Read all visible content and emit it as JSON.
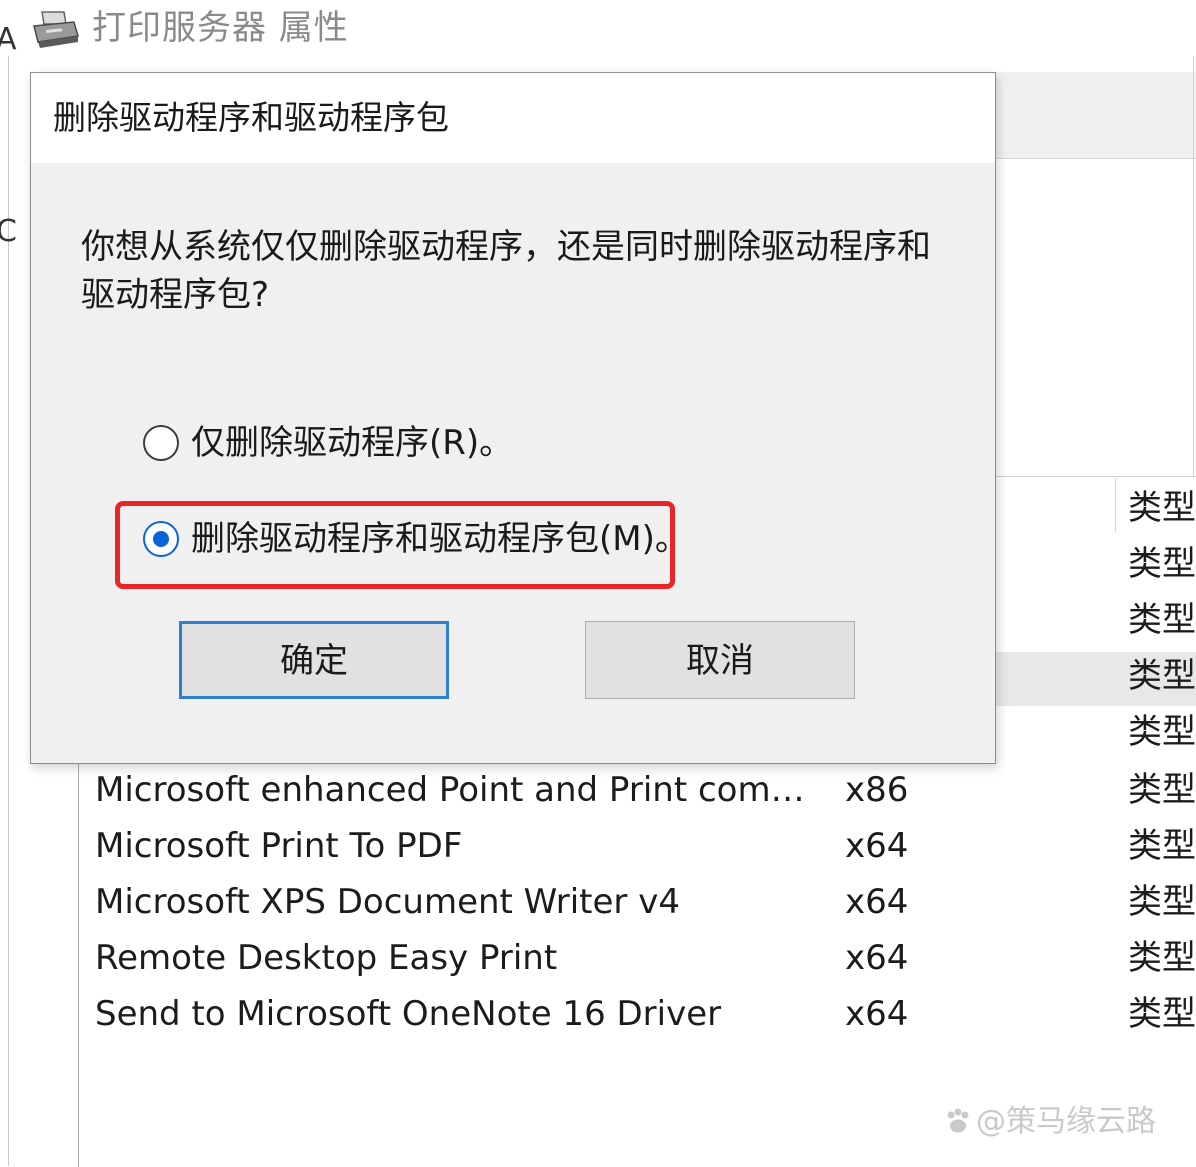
{
  "background_window": {
    "title": "打印服务器 属性",
    "left_edge_glyphs": [
      "A",
      "C"
    ],
    "drivers": [
      {
        "name": "Microsoft enhanced Point and Print com…",
        "environment": "x86",
        "type": "类型"
      },
      {
        "name": "Microsoft Print To PDF",
        "environment": "x64",
        "type": "类型"
      },
      {
        "name": "Microsoft XPS Document Writer v4",
        "environment": "x64",
        "type": "类型"
      },
      {
        "name": "Remote Desktop Easy Print",
        "environment": "x64",
        "type": "类型"
      },
      {
        "name": "Send to Microsoft OneNote 16 Driver",
        "environment": "x64",
        "type": "类型"
      }
    ],
    "type_column_cells_above": [
      "类型",
      "类型",
      "类型",
      "类型",
      "类型"
    ]
  },
  "dialog": {
    "title": "删除驱动程序和驱动程序包",
    "question": "你想从系统仅仅删除驱动程序，还是同时删除驱动程序和驱动程序包?",
    "options": [
      {
        "label": "仅删除驱动程序(R)。",
        "checked": false
      },
      {
        "label": "删除驱动程序和驱动程序包(M)。",
        "checked": true
      }
    ],
    "ok_label": "确定",
    "cancel_label": "取消"
  },
  "annotation": {
    "highlight_color": "#e8262a"
  },
  "accent_color": "#0a64d8",
  "watermark": "@策马缘云路"
}
